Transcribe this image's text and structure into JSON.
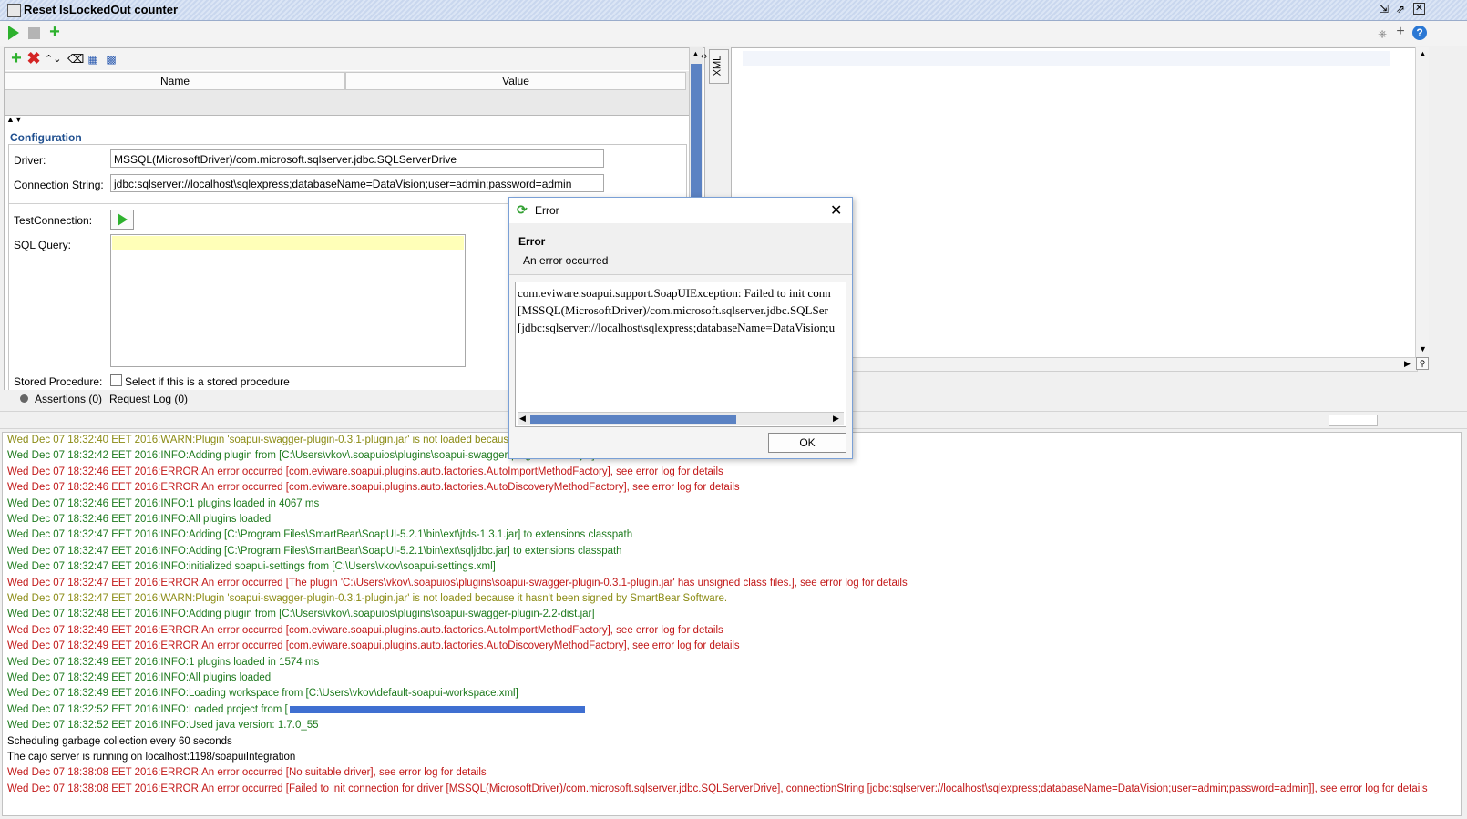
{
  "window": {
    "title": "Reset IsLockedOut counter"
  },
  "properties": {
    "col_name": "Name",
    "col_value": "Value"
  },
  "config": {
    "section_title": "Configuration",
    "driver_label": "Driver:",
    "driver_value": "MSSQL(MicrosoftDriver)/com.microsoft.sqlserver.jdbc.SQLServerDrive",
    "conn_label": "Connection String:",
    "conn_value": "jdbc:sqlserver://localhost\\sqlexpress;databaseName=DataVision;user=admin;password=admin",
    "testconn_label": "TestConnection:",
    "sql_label": "SQL Query:",
    "stored_label": "Stored Procedure:",
    "stored_checkbox_text": "Select if this is a stored procedure"
  },
  "editor": {
    "xml_tab": "XML"
  },
  "tabs": {
    "assertions": "Assertions (0)",
    "request_log": "Request Log (0)"
  },
  "dialog": {
    "title": "Error",
    "heading": "Error",
    "subheading": "An error occurred",
    "lines": [
      "com.eviware.soapui.support.SoapUIException: Failed to init conn",
      "[MSSQL(MicrosoftDriver)/com.microsoft.sqlserver.jdbc.SQLSer",
      "[jdbc:sqlserver://localhost\\sqlexpress;databaseName=DataVision;u"
    ],
    "ok_label": "OK"
  },
  "log": [
    {
      "level": "warn",
      "text": "Wed Dec 07 18:32:40 EET 2016:WARN:Plugin 'soapui-swagger-plugin-0.3.1-plugin.jar' is not loaded because"
    },
    {
      "level": "info",
      "text": "Wed Dec 07 18:32:42 EET 2016:INFO:Adding plugin from [C:\\Users\\vkov\\.soapuios\\plugins\\soapui-swagger-plugin-2.2-dist.jar]"
    },
    {
      "level": "error",
      "text": "Wed Dec 07 18:32:46 EET 2016:ERROR:An error occurred [com.eviware.soapui.plugins.auto.factories.AutoImportMethodFactory], see error log for details"
    },
    {
      "level": "error",
      "text": "Wed Dec 07 18:32:46 EET 2016:ERROR:An error occurred [com.eviware.soapui.plugins.auto.factories.AutoDiscoveryMethodFactory], see error log for details"
    },
    {
      "level": "info",
      "text": "Wed Dec 07 18:32:46 EET 2016:INFO:1 plugins loaded in 4067 ms"
    },
    {
      "level": "info",
      "text": "Wed Dec 07 18:32:46 EET 2016:INFO:All plugins loaded"
    },
    {
      "level": "info",
      "text": "Wed Dec 07 18:32:47 EET 2016:INFO:Adding [C:\\Program Files\\SmartBear\\SoapUI-5.2.1\\bin\\ext\\jtds-1.3.1.jar] to extensions classpath"
    },
    {
      "level": "info",
      "text": "Wed Dec 07 18:32:47 EET 2016:INFO:Adding [C:\\Program Files\\SmartBear\\SoapUI-5.2.1\\bin\\ext\\sqljdbc.jar] to extensions classpath"
    },
    {
      "level": "info",
      "text": "Wed Dec 07 18:32:47 EET 2016:INFO:initialized soapui-settings from [C:\\Users\\vkov\\soapui-settings.xml]"
    },
    {
      "level": "error",
      "text": "Wed Dec 07 18:32:47 EET 2016:ERROR:An error occurred [The plugin 'C:\\Users\\vkov\\.soapuios\\plugins\\soapui-swagger-plugin-0.3.1-plugin.jar' has unsigned class files.], see error log for details"
    },
    {
      "level": "warn",
      "text": "Wed Dec 07 18:32:47 EET 2016:WARN:Plugin 'soapui-swagger-plugin-0.3.1-plugin.jar' is not loaded because it hasn't been signed by SmartBear Software."
    },
    {
      "level": "info",
      "text": "Wed Dec 07 18:32:48 EET 2016:INFO:Adding plugin from [C:\\Users\\vkov\\.soapuios\\plugins\\soapui-swagger-plugin-2.2-dist.jar]"
    },
    {
      "level": "error",
      "text": "Wed Dec 07 18:32:49 EET 2016:ERROR:An error occurred [com.eviware.soapui.plugins.auto.factories.AutoImportMethodFactory], see error log for details"
    },
    {
      "level": "error",
      "text": "Wed Dec 07 18:32:49 EET 2016:ERROR:An error occurred [com.eviware.soapui.plugins.auto.factories.AutoDiscoveryMethodFactory], see error log for details"
    },
    {
      "level": "info",
      "text": "Wed Dec 07 18:32:49 EET 2016:INFO:1 plugins loaded in 1574 ms"
    },
    {
      "level": "info",
      "text": "Wed Dec 07 18:32:49 EET 2016:INFO:All plugins loaded"
    },
    {
      "level": "info",
      "text": "Wed Dec 07 18:32:49 EET 2016:INFO:Loading workspace from [C:\\Users\\vkov\\default-soapui-workspace.xml]"
    },
    {
      "level": "info",
      "text": "Wed Dec 07 18:32:52 EET 2016:INFO:Loaded project from ["
    },
    {
      "level": "info",
      "text": "Wed Dec 07 18:32:52 EET 2016:INFO:Used java version: 1.7.0_55"
    },
    {
      "level": "plain",
      "text": "Scheduling garbage collection every 60 seconds"
    },
    {
      "level": "plain",
      "text": "The cajo server is running on localhost:1198/soapuiIntegration"
    },
    {
      "level": "error",
      "text": "Wed Dec 07 18:38:08 EET 2016:ERROR:An error occurred [No suitable driver], see error log for details"
    },
    {
      "level": "error",
      "text": "Wed Dec 07 18:38:08 EET 2016:ERROR:An error occurred [Failed to init connection for driver [MSSQL(MicrosoftDriver)/com.microsoft.sqlserver.jdbc.SQLServerDrive], connectionString [jdbc:sqlserver://localhost\\sqlexpress;databaseName=DataVision;user=admin;password=admin]], see error log for details"
    }
  ],
  "colors": {
    "info": "#1e7a1e",
    "warn": "#8b8b14",
    "error": "#c21818",
    "accent": "#5b82c3"
  }
}
